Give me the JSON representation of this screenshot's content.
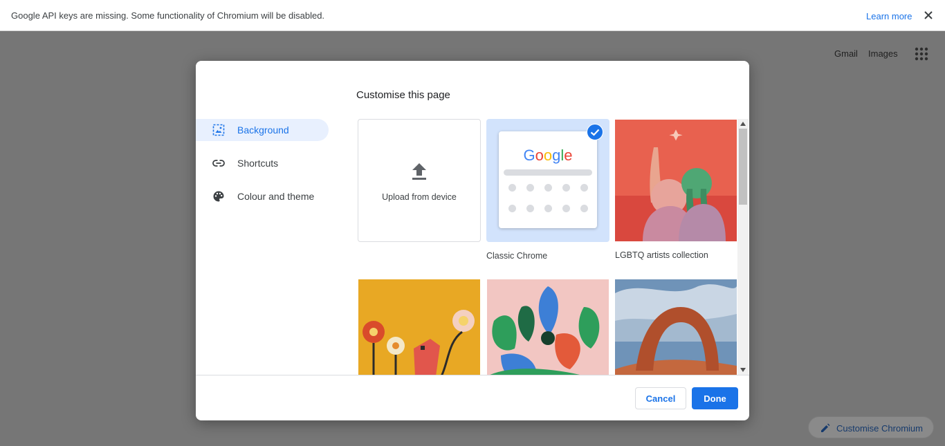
{
  "infobar": {
    "message": "Google API keys are missing. Some functionality of Chromium will be disabled.",
    "learn_more": "Learn more",
    "close_icon": "close-icon"
  },
  "ntp": {
    "gmail": "Gmail",
    "images": "Images",
    "apps_icon": "apps-grid-icon",
    "customise_label": "Customise Chromium"
  },
  "dialog": {
    "title": "Customise this page",
    "menu": [
      {
        "label": "Background",
        "icon": "image-icon",
        "selected": true
      },
      {
        "label": "Shortcuts",
        "icon": "link-icon",
        "selected": false
      },
      {
        "label": "Colour and theme",
        "icon": "palette-icon",
        "selected": false
      }
    ],
    "tiles": {
      "upload": "Upload from device",
      "classic": "Classic Chrome",
      "lgbtq": "LGBTQ artists collection"
    },
    "google_logo": "Google",
    "cancel": "Cancel",
    "done": "Done"
  },
  "colors": {
    "accent": "#1a73e8",
    "selected_bg": "#e8f0fe",
    "scrim": "#767676"
  }
}
